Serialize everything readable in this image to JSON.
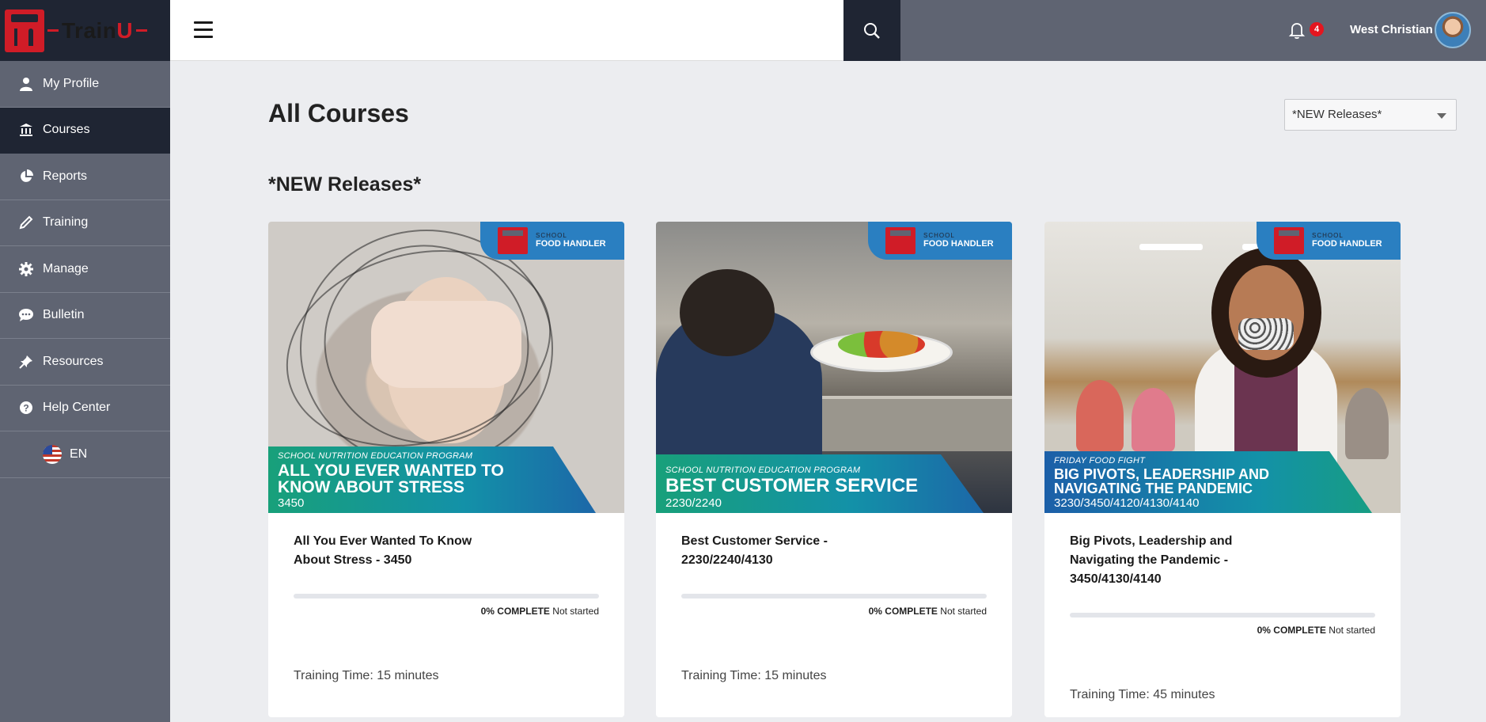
{
  "app": {
    "logo_text_main": "Train",
    "logo_text_accent": "U",
    "brand_color": "#d01c27",
    "dark_color": "#1f2533",
    "sidebar_color": "#5f6472"
  },
  "sidebar": {
    "items": [
      {
        "label": "My Profile",
        "icon": "user-icon"
      },
      {
        "label": "Courses",
        "icon": "bank-icon",
        "active": true
      },
      {
        "label": "Reports",
        "icon": "pie-chart-icon"
      },
      {
        "label": "Training",
        "icon": "pencil-icon"
      },
      {
        "label": "Manage",
        "icon": "gear-icon"
      },
      {
        "label": "Bulletin",
        "icon": "chat-icon"
      },
      {
        "label": "Resources",
        "icon": "pin-icon"
      },
      {
        "label": "Help Center",
        "icon": "question-icon"
      }
    ],
    "language": {
      "label": "EN",
      "icon": "us-flag-icon"
    }
  },
  "topbar": {
    "notifications_count": "4",
    "user_name": "West Christian"
  },
  "main": {
    "page_title": "All Courses",
    "filter_selected": "*NEW Releases*",
    "section_title": "*NEW Releases*",
    "courses": [
      {
        "banner_program": "SCHOOL NUTRITION EDUCATION PROGRAM",
        "banner_title": "ALL YOU EVER WANTED TO KNOW ABOUT STRESS",
        "banner_code": "3450",
        "title": "All You Ever Wanted To Know About Stress - 3450",
        "progress": 0,
        "progress_percent": "0% COMPLETE",
        "status": "Not started",
        "training_time": "Training Time: 15 minutes"
      },
      {
        "banner_program": "SCHOOL NUTRITION EDUCATION PROGRAM",
        "banner_title": "BEST CUSTOMER SERVICE",
        "banner_code": "2230/2240",
        "title": "Best Customer Service - 2230/2240/4130",
        "progress": 0,
        "progress_percent": "0% COMPLETE",
        "status": "Not started",
        "training_time": "Training Time: 15 minutes"
      },
      {
        "banner_program": "FRIDAY FOOD FIGHT",
        "banner_title": "BIG PIVOTS, LEADERSHIP AND NAVIGATING THE PANDEMIC",
        "banner_code": "3230/3450/4120/4130/4140",
        "title": "Big Pivots, Leadership and Navigating the Pandemic - 3450/4130/4140",
        "progress": 0,
        "progress_percent": "0% COMPLETE",
        "status": "Not started",
        "training_time": "Training Time: 45 minutes"
      }
    ],
    "brand_badge": {
      "line1": "SCHOOL",
      "line2": "FOOD HANDLER"
    }
  }
}
